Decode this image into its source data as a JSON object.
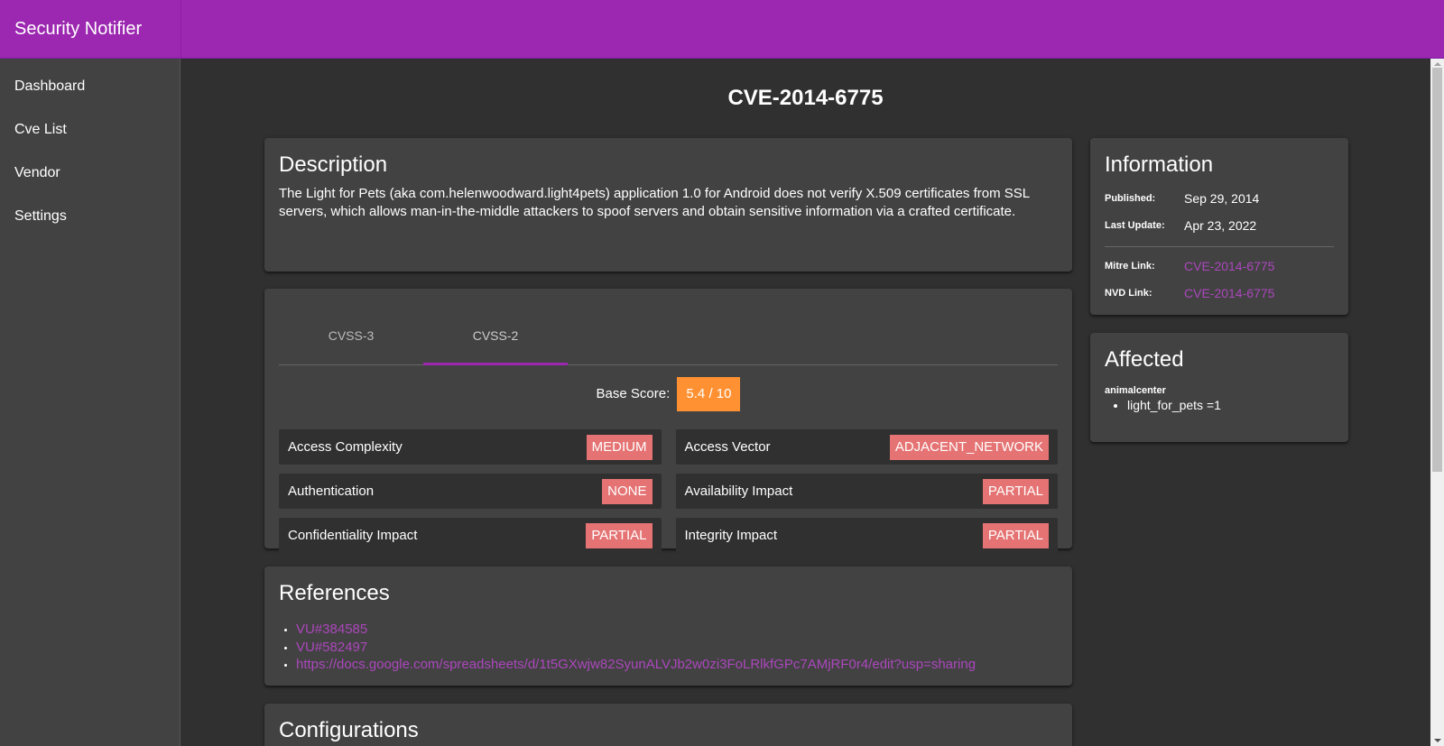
{
  "app": {
    "title": "Security Notifier"
  },
  "sidebar": {
    "items": [
      {
        "label": "Dashboard"
      },
      {
        "label": "Cve List"
      },
      {
        "label": "Vendor"
      },
      {
        "label": "Settings"
      }
    ]
  },
  "page": {
    "title": "CVE-2014-6775"
  },
  "description": {
    "heading": "Description",
    "text": "The Light for Pets (aka com.helenwoodward.light4pets) application 1.0 for Android does not verify X.509 certificates from SSL servers, which allows man-in-the-middle attackers to spoof servers and obtain sensitive information via a crafted certificate."
  },
  "cvss": {
    "tabs": [
      {
        "label": "CVSS-3"
      },
      {
        "label": "CVSS-2"
      }
    ],
    "active_tab": "CVSS-2",
    "base_score_label": "Base Score:",
    "base_score": "5.4 / 10",
    "metrics": [
      {
        "label": "Access Complexity",
        "value": "MEDIUM"
      },
      {
        "label": "Access Vector",
        "value": "ADJACENT_NETWORK"
      },
      {
        "label": "Authentication",
        "value": "NONE"
      },
      {
        "label": "Availability Impact",
        "value": "PARTIAL"
      },
      {
        "label": "Confidentiality Impact",
        "value": "PARTIAL"
      },
      {
        "label": "Integrity Impact",
        "value": "PARTIAL"
      }
    ]
  },
  "references": {
    "heading": "References",
    "items": [
      "VU#384585",
      "VU#582497",
      "https://docs.google.com/spreadsheets/d/1t5GXwjw82SyunALVJb2w0zi3FoLRlkfGPc7AMjRF0r4/edit?usp=sharing"
    ]
  },
  "configurations": {
    "heading": "Configurations"
  },
  "information": {
    "heading": "Information",
    "published_label": "Published:",
    "published": "Sep 29, 2014",
    "updated_label": "Last Update:",
    "updated": "Apr 23, 2022",
    "mitre_label": "Mitre Link:",
    "mitre": "CVE-2014-6775",
    "nvd_label": "NVD Link:",
    "nvd": "CVE-2014-6775"
  },
  "affected": {
    "heading": "Affected",
    "vendor": "animalcenter",
    "products": [
      "light_for_pets =1"
    ]
  },
  "colors": {
    "primary": "#9c27b0",
    "score": "#ff9133",
    "severity": "#e57373",
    "link": "#ab47bc"
  }
}
